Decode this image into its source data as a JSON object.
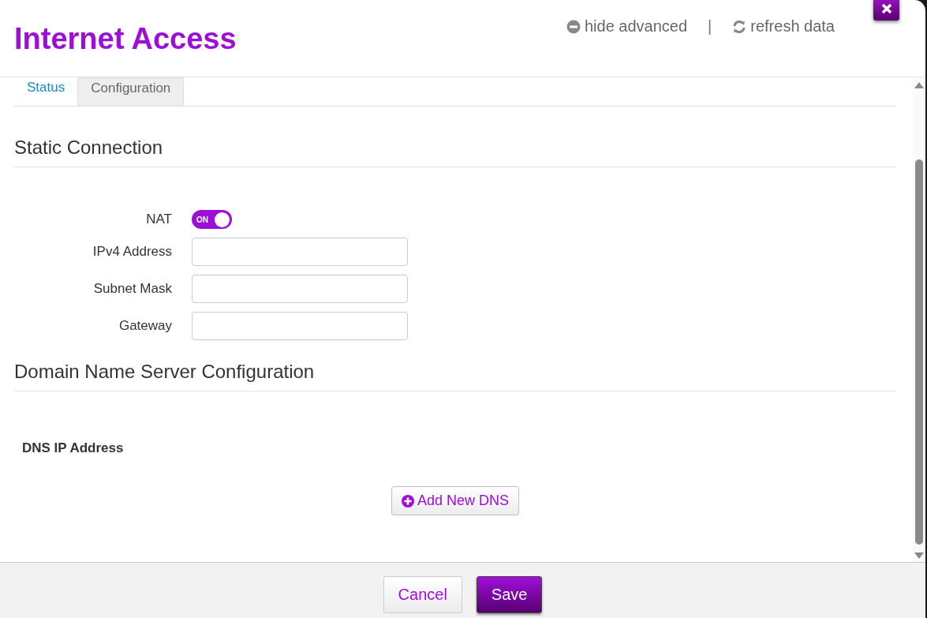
{
  "dialog": {
    "title": "Internet Access",
    "header_links": [
      {
        "kind": "hide",
        "label": "hide advanced"
      },
      {
        "kind": "refresh",
        "label": "refresh data"
      }
    ],
    "separator": "|"
  },
  "tabs": [
    {
      "label": "Status",
      "selected": false
    },
    {
      "label": "Configuration",
      "selected": true
    }
  ],
  "static_section": {
    "title": "Static Connection",
    "fields": [
      {
        "kind": "toggle",
        "label": "NAT",
        "on": true,
        "toggle_text": "ON"
      },
      {
        "kind": "input",
        "label": "IPv4 Address"
      },
      {
        "kind": "input",
        "label": "Subnet Mask"
      },
      {
        "kind": "input",
        "label": "Gateway"
      }
    ]
  },
  "dns_section": {
    "title": "Domain Name Server Configuration",
    "label": "DNS IP Address",
    "add_button": "Add New DNS"
  },
  "footer": {
    "buttons": [
      {
        "label": "Cancel",
        "kind": "secondary"
      },
      {
        "label": "Save",
        "kind": "primary"
      }
    ]
  }
}
